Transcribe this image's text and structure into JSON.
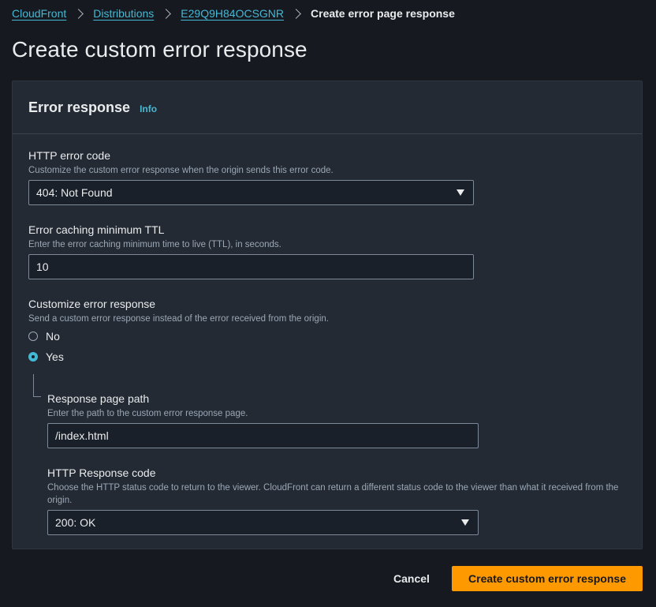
{
  "breadcrumb": {
    "items": [
      "CloudFront",
      "Distributions",
      "E29Q9H84OCSGNR"
    ],
    "current": "Create error page response"
  },
  "page": {
    "title": "Create custom error response"
  },
  "panel": {
    "title": "Error response",
    "info_label": "Info"
  },
  "http_error_code": {
    "label": "HTTP error code",
    "description": "Customize the custom error response when the origin sends this error code.",
    "selected": "404: Not Found"
  },
  "ttl": {
    "label": "Error caching minimum TTL",
    "description": "Enter the error caching minimum time to live (TTL), in seconds.",
    "value": "10"
  },
  "customize": {
    "label": "Customize error response",
    "description": "Send a custom error response instead of the error received from the origin.",
    "options": [
      "No",
      "Yes"
    ],
    "selected": "Yes"
  },
  "response_page_path": {
    "label": "Response page path",
    "description": "Enter the path to the custom error response page.",
    "value": "/index.html"
  },
  "http_response_code": {
    "label": "HTTP Response code",
    "description": "Choose the HTTP status code to return to the viewer. CloudFront can return a different status code to the viewer than what it received from the origin.",
    "selected": "200: OK"
  },
  "actions": {
    "cancel_label": "Cancel",
    "submit_label": "Create custom error response"
  },
  "colors": {
    "accent": "#ff9900",
    "link": "#44b9d6",
    "background": "#16191f",
    "panel": "#232a33"
  }
}
